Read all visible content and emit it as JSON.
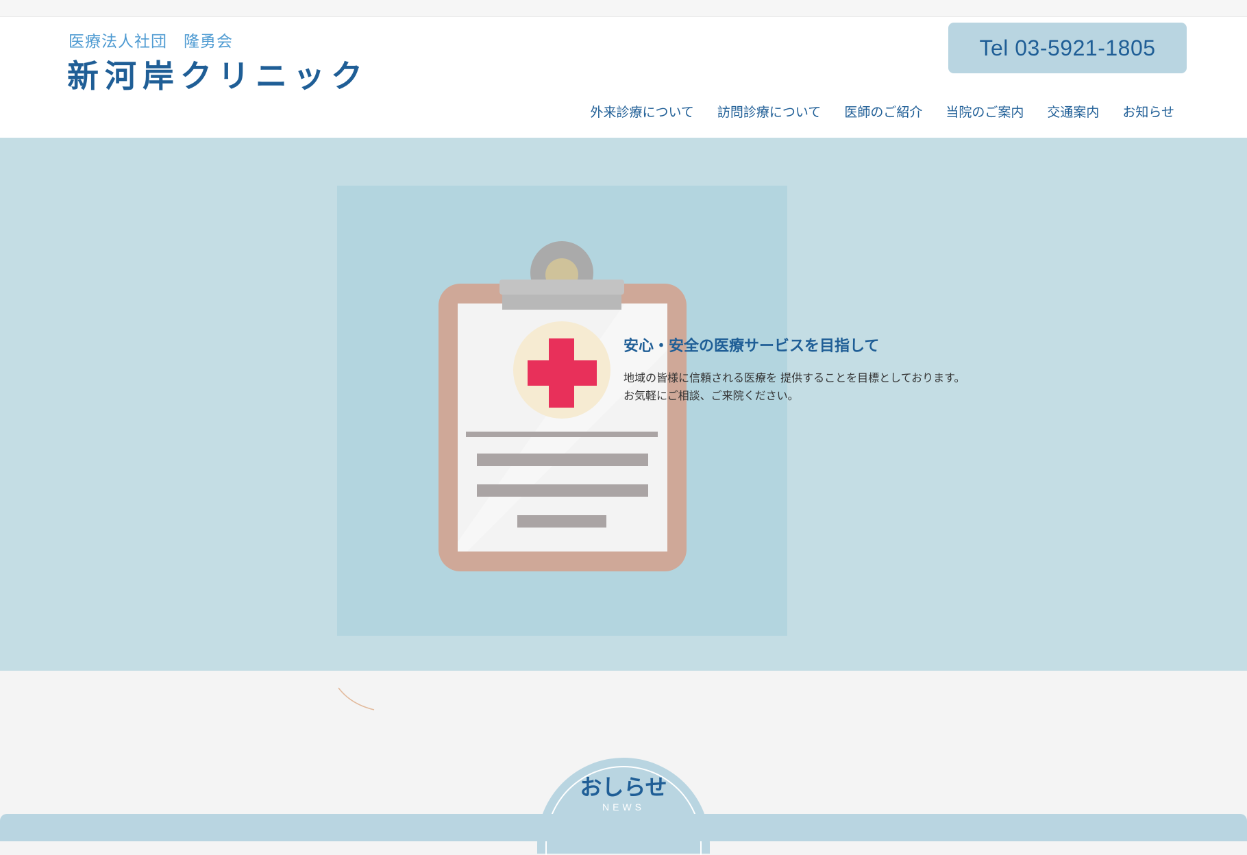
{
  "header": {
    "logo_sub": "医療法人社団　隆勇会",
    "logo_main": "新河岸クリニック",
    "tel": "Tel 03-5921-1805"
  },
  "nav": {
    "items": [
      "外来診療について",
      "訪問診療について",
      "医師のご紹介",
      "当院のご案内",
      "交通案内",
      "お知らせ"
    ]
  },
  "hero": {
    "title": "安心・安全の医療サービスを目指して",
    "lines": [
      "地域の皆様に信頼される医療を 提供することを目標としております。",
      "お気軽にご相談、ご来院ください。"
    ],
    "image_icon": "clipboard-medical-icon"
  },
  "news": {
    "title": "おしらせ",
    "subtitle": "NEWS"
  },
  "colors": {
    "brand_blue": "#1f5e96",
    "light_blue": "#4f9bd2",
    "hero_bg": "#c4dde4",
    "tab_bg": "#b9d5e1",
    "cross_red": "#e8305a"
  }
}
